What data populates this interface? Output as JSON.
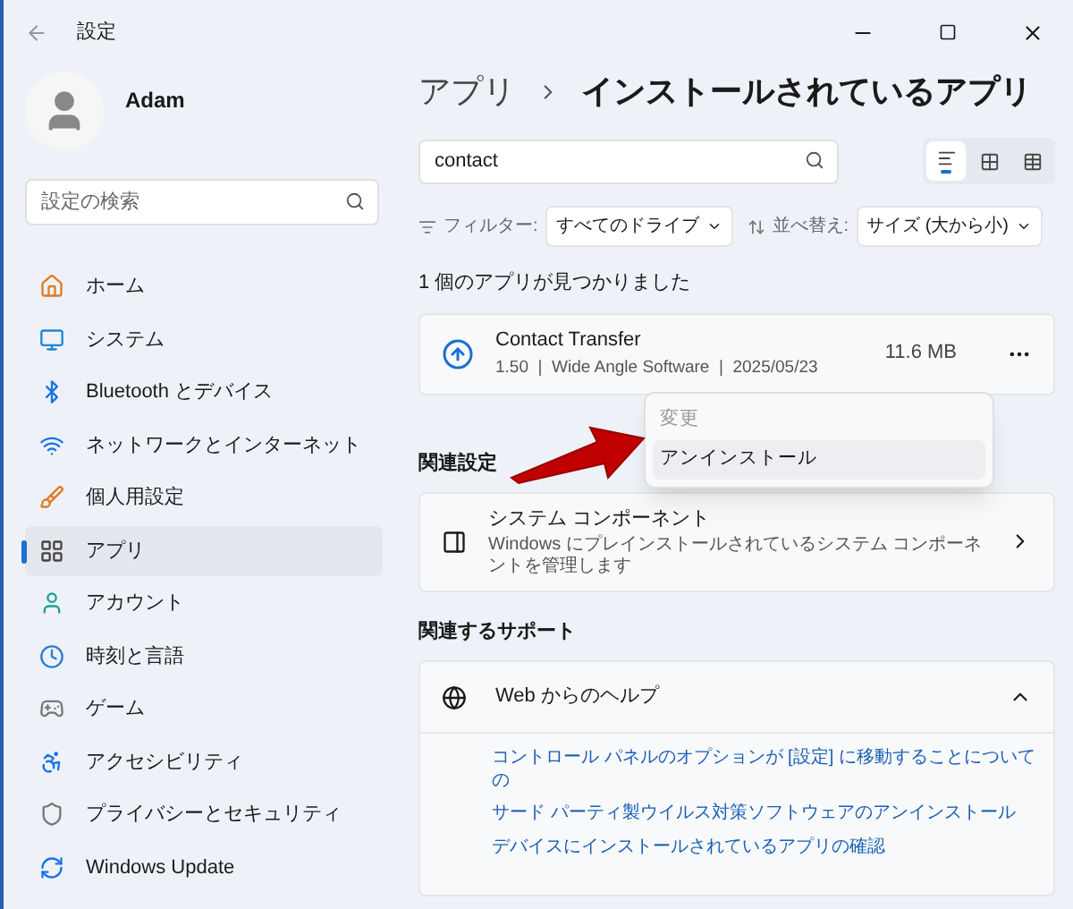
{
  "window": {
    "title": "設定"
  },
  "user": {
    "name": "Adam"
  },
  "sidebar": {
    "search": {
      "placeholder": "設定の検索"
    },
    "items": [
      {
        "label": "ホーム",
        "kind": "home",
        "selected": false
      },
      {
        "label": "システム",
        "kind": "system",
        "selected": false
      },
      {
        "label": "Bluetooth とデバイス",
        "kind": "bluetooth",
        "selected": false
      },
      {
        "label": "ネットワークとインターネット",
        "kind": "network",
        "selected": false
      },
      {
        "label": "個人用設定",
        "kind": "personalize",
        "selected": false
      },
      {
        "label": "アプリ",
        "kind": "apps",
        "selected": true
      },
      {
        "label": "アカウント",
        "kind": "account",
        "selected": false
      },
      {
        "label": "時刻と言語",
        "kind": "time",
        "selected": false
      },
      {
        "label": "ゲーム",
        "kind": "game",
        "selected": false
      },
      {
        "label": "アクセシビリティ",
        "kind": "accessibility",
        "selected": false
      },
      {
        "label": "プライバシーとセキュリティ",
        "kind": "privacy",
        "selected": false
      },
      {
        "label": "Windows Update",
        "kind": "update",
        "selected": false
      }
    ]
  },
  "breadcrumb": {
    "parent": "アプリ",
    "current": "インストールされているアプリ"
  },
  "app_search": {
    "value": "contact"
  },
  "view_buttons": [
    {
      "kind": "list",
      "selected": true
    },
    {
      "kind": "tiles",
      "selected": false
    },
    {
      "kind": "grid",
      "selected": false
    }
  ],
  "filter": {
    "label": "フィルター:",
    "value": "すべてのドライブ"
  },
  "sort": {
    "label": "並べ替え:",
    "value": "サイズ (大から小)"
  },
  "result_count": "1 個のアプリが見つかりました",
  "apps": [
    {
      "name": "Contact Transfer",
      "details": "1.50  |  Wide Angle Software  |  2025/05/23",
      "size": "11.6 MB"
    }
  ],
  "context_menu": [
    {
      "label": "変更",
      "disabled": true,
      "selected": false
    },
    {
      "label": "アンインストール",
      "disabled": false,
      "selected": true
    }
  ],
  "related_settings": {
    "title": "関連設定",
    "items": [
      {
        "title": "システム コンポーネント",
        "description": "Windows にプレインストールされているシステム コンポーネントを管理します"
      }
    ]
  },
  "support": {
    "title": "関連するサポート",
    "card": {
      "title": "Web からのヘルプ",
      "expanded": true,
      "links": [
        "コントロール パネルのオプションが [設定] に移動することについての",
        "サード パーティ製ウイルス対策ソフトウェアのアンインストール",
        "デバイスにインストールされているアプリの確認"
      ]
    }
  }
}
